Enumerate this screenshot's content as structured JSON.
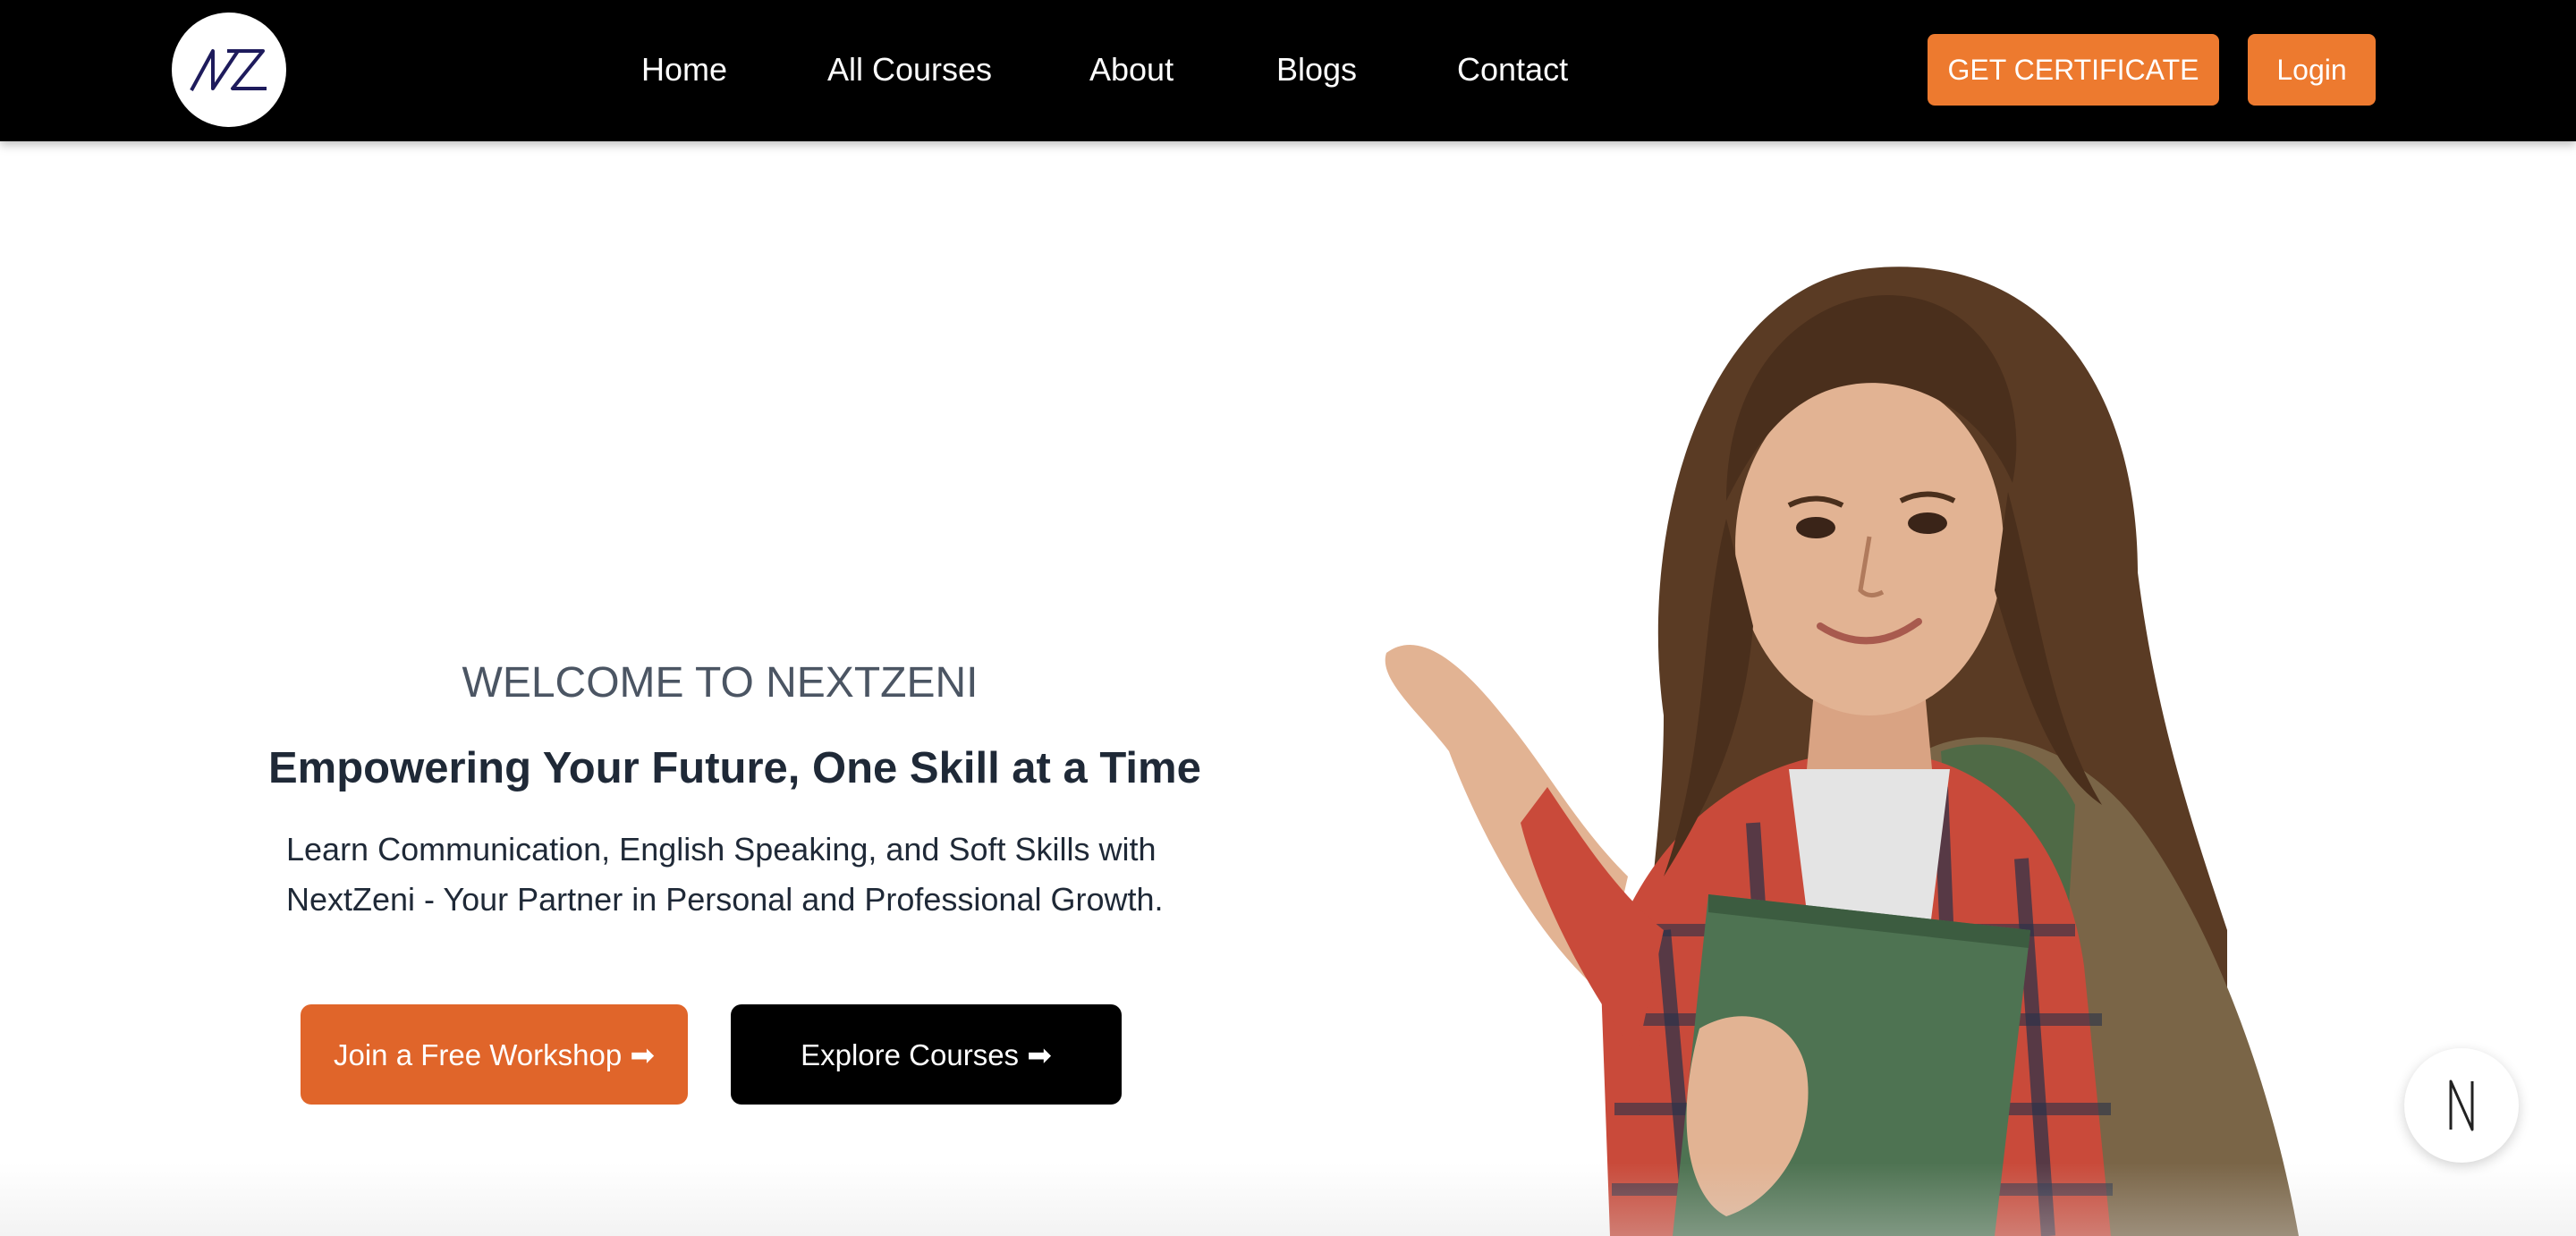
{
  "navbar": {
    "logo_icon": "nz-logo-icon",
    "links": [
      {
        "label": "Home"
      },
      {
        "label": "All Courses"
      },
      {
        "label": "About"
      },
      {
        "label": "Blogs"
      },
      {
        "label": "Contact"
      }
    ],
    "certificate_label": "GET CERTIFICATE",
    "login_label": "Login"
  },
  "hero": {
    "welcome": "WELCOME TO NEXTZENI",
    "headline": "Empowering Your Future, One Skill at a Time",
    "description": "Learn Communication, English Speaking, and Soft Skills with NextZeni - Your Partner in Personal and Professional Growth.",
    "workshop_button": "Join a Free Workshop ➡",
    "explore_button": "Explore Courses ➡",
    "image": "student-girl-pointing-photo"
  },
  "chat_widget": {
    "icon": "n-logo-icon"
  },
  "colors": {
    "navbar_bg": "#000000",
    "accent_orange": "#ed7a2f",
    "workshop_orange": "#e0652a",
    "text_dark": "#1f2937",
    "text_muted": "#4b5563"
  }
}
